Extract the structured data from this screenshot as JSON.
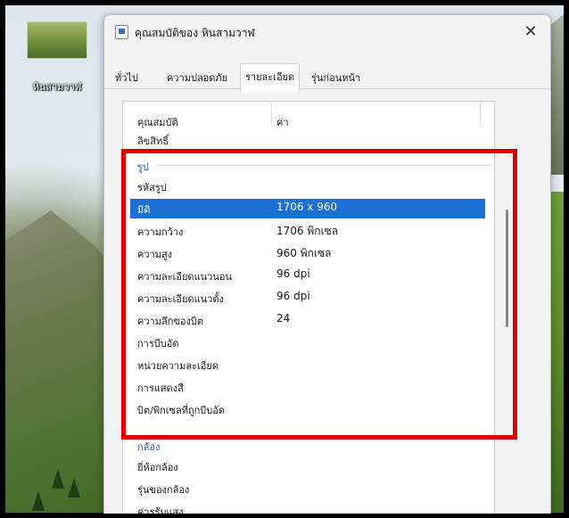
{
  "desktop": {
    "icon_label": "หินสามวาฬ"
  },
  "window": {
    "title": "คุณสมบัติของ หินสามวาฬ",
    "close_glyph": "✕",
    "tabs": [
      {
        "label": "ทั่วไป"
      },
      {
        "label": "ความปลอดภัย"
      },
      {
        "label": "รายละเอียด",
        "active": true
      },
      {
        "label": "รุ่นก่อนหน้า"
      }
    ],
    "columns": {
      "property": "คุณสมบัติ",
      "value": "ค่า"
    },
    "rows_top": [
      {
        "key": "ลิขสิทธิ์",
        "value": ""
      }
    ],
    "group_image": "รูป",
    "image_rows": [
      {
        "key": "รหัสรูป",
        "value": ""
      },
      {
        "key": "มิติ",
        "value": "1706 x 960",
        "selected": true
      },
      {
        "key": "ความกว้าง",
        "value": "1706 พิกเซล"
      },
      {
        "key": "ความสูง",
        "value": "960 พิกเซล"
      },
      {
        "key": "ความละเอียดแนวนอน",
        "value": "96 dpi"
      },
      {
        "key": "ความละเอียดแนวตั้ง",
        "value": "96 dpi"
      },
      {
        "key": "ความลึกของบิต",
        "value": "24"
      },
      {
        "key": "การบีบอัด",
        "value": ""
      },
      {
        "key": "หน่วยความละเอียด",
        "value": ""
      },
      {
        "key": "การแสดงสี",
        "value": ""
      },
      {
        "key": "บิต/พิกเซลที่ถูกบีบอัด",
        "value": ""
      }
    ],
    "group_camera": "กล้อง",
    "camera_rows": [
      {
        "key": "ยี่ห้อกล้อง",
        "value": ""
      },
      {
        "key": "รุ่นของกล้อง",
        "value": ""
      },
      {
        "key": "ค่ารูรับแสง",
        "value": ""
      }
    ]
  },
  "colors": {
    "selection": "#1c6fd3",
    "highlight_border": "#e00000",
    "group_header": "#2a5fb3"
  }
}
